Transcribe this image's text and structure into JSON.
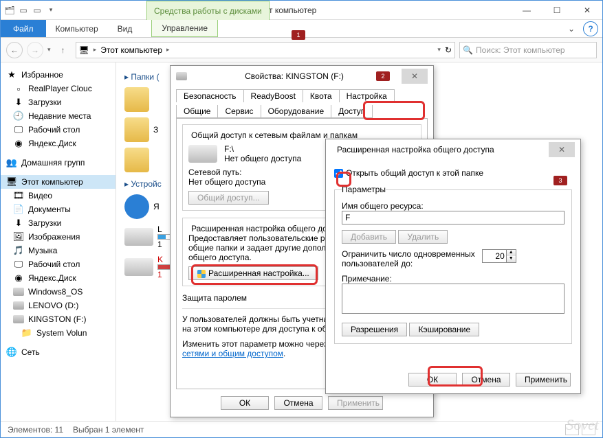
{
  "window": {
    "title": "Этот компьютер",
    "ribbon_tools_label": "Средства работы с дисками",
    "tabs": {
      "file": "Файл",
      "computer": "Компьютер",
      "view": "Вид",
      "manage": "Управление"
    },
    "addressbar": {
      "crumb": "Этот компьютер",
      "search_placeholder": "Поиск: Этот компьютер"
    },
    "statusbar": {
      "count": "Элементов: 11",
      "selected": "Выбран 1 элемент"
    }
  },
  "nav": {
    "favorites": {
      "label": "Избранное",
      "items": [
        "RealPlayer Clouc",
        "Загрузки",
        "Недавние места",
        "Рабочий стол",
        "Яндекс.Диск"
      ]
    },
    "homegroup": "Домашняя групп",
    "thispc": {
      "label": "Этот компьютер",
      "items": [
        "Видео",
        "Документы",
        "Загрузки",
        "Изображения",
        "Музыка",
        "Рабочий стол",
        "Яндекс.Диск",
        "Windows8_OS",
        "LENOVO (D:)",
        "KINGSTON (F:)"
      ],
      "sub": "System Volun"
    },
    "network": "Сеть"
  },
  "content": {
    "folders_header": "Папки (",
    "devices_header": "Устройс"
  },
  "props": {
    "title": "Свойства: KINGSTON (F:)",
    "tabs_top": [
      "Безопасность",
      "ReadyBoost",
      "Квота",
      "Настройка"
    ],
    "tabs_bot": [
      "Общие",
      "Сервис",
      "Оборудование",
      "Доступ"
    ],
    "share_group": "Общий доступ к сетевым файлам и папкам",
    "drive_label": "F:\\",
    "no_share": "Нет общего доступа",
    "netpath_label": "Сетевой путь:",
    "netpath_value": "Нет общего доступа",
    "share_btn": "Общий доступ...",
    "adv_group": "Расширенная настройка общего доступа",
    "adv_desc_l1": "Предоставляет пользовательские разр",
    "adv_desc_l2": "общие папки и задает другие дополните",
    "adv_desc_l3": "общего доступа.",
    "adv_btn": "Расширенная настройка...",
    "pw_group": "Защита паролем",
    "pw_l1": "У пользователей должны быть учетная",
    "pw_l2": "на этом компьютере для доступа к общи",
    "pw_change": "Изменить этот параметр можно через ",
    "pw_link": "сетями и общим доступом",
    "ok": "ОК",
    "cancel": "Отмена",
    "apply": "Применить"
  },
  "adv": {
    "title": "Расширенная настройка общего доступа",
    "open_share": "Открыть общий доступ к этой папке",
    "params": "Параметры",
    "name_label": "Имя общего ресурса:",
    "name_value": "F",
    "add": "Добавить",
    "remove": "Удалить",
    "limit_l1": "Ограничить число одновременных",
    "limit_l2": "пользователей до:",
    "limit_value": "20",
    "note_label": "Примечание:",
    "perms": "Разрешения",
    "cache": "Кэширование",
    "ok": "ОК",
    "cancel": "Отмена",
    "apply": "Применить"
  },
  "annotations": {
    "b1": "1",
    "b2": "2",
    "b3": "3"
  }
}
